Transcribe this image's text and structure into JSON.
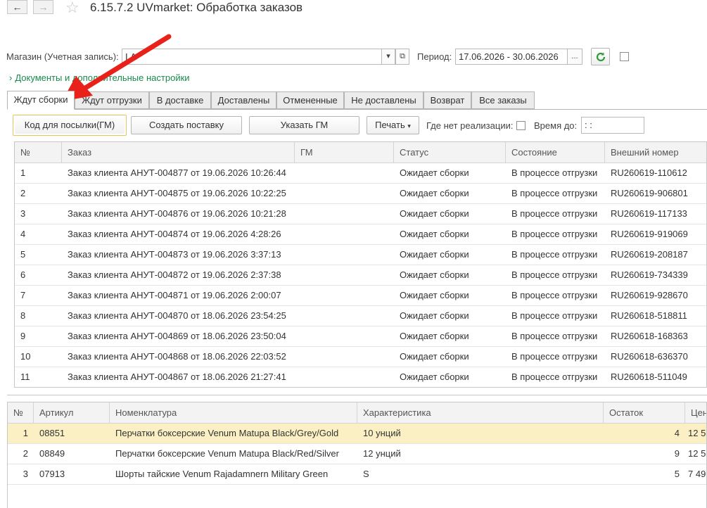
{
  "window": {
    "title": "6.15.7.2 UVmarket: Обработка заказов",
    "back": "←",
    "forward": "→",
    "star": "☆"
  },
  "form": {
    "shop_label": "Магазин (Учетная запись):",
    "shop_value": "I.A",
    "period_label": "Период:",
    "period_value": "17.06.2026 - 30.06.2026",
    "period_btn": "...",
    "docs_link": "Документы и дополнительные настройки"
  },
  "tabs": [
    "Ждут сборки",
    "Ждут отгрузки",
    "В доставке",
    "Доставлены",
    "Отмененные",
    "Не доставлены",
    "Возврат",
    "Все заказы"
  ],
  "toolbar": {
    "code_btn": "Код для посылки(ГМ)",
    "create_btn": "Создать поставку",
    "gm_btn": "Указать ГМ",
    "print_btn": "Печать",
    "no_real_label": "Где нет реализации:",
    "time_label": "Время до:",
    "time_value": " :  : "
  },
  "orders": {
    "columns": [
      "№",
      "Заказ",
      "ГМ",
      "Статус",
      "Состояние",
      "Внешний номер"
    ],
    "rows": [
      [
        "1",
        "Заказ клиента АНУТ-004877 от 19.06.2026 10:26:44",
        "",
        "Ожидает сборки",
        "В процессе отгрузки",
        "RU260619-110612"
      ],
      [
        "2",
        "Заказ клиента АНУТ-004875 от 19.06.2026 10:22:25",
        "",
        "Ожидает сборки",
        "В процессе отгрузки",
        "RU260619-906801"
      ],
      [
        "3",
        "Заказ клиента АНУТ-004876 от 19.06.2026 10:21:28",
        "",
        "Ожидает сборки",
        "В процессе отгрузки",
        "RU260619-117133"
      ],
      [
        "4",
        "Заказ клиента АНУТ-004874 от 19.06.2026 4:28:26",
        "",
        "Ожидает сборки",
        "В процессе отгрузки",
        "RU260619-919069"
      ],
      [
        "5",
        "Заказ клиента АНУТ-004873 от 19.06.2026 3:37:13",
        "",
        "Ожидает сборки",
        "В процессе отгрузки",
        "RU260619-208187"
      ],
      [
        "6",
        "Заказ клиента АНУТ-004872 от 19.06.2026 2:37:38",
        "",
        "Ожидает сборки",
        "В процессе отгрузки",
        "RU260619-734339"
      ],
      [
        "7",
        "Заказ клиента АНУТ-004871 от 19.06.2026 2:00:07",
        "",
        "Ожидает сборки",
        "В процессе отгрузки",
        "RU260619-928670"
      ],
      [
        "8",
        "Заказ клиента АНУТ-004870 от 18.06.2026 23:54:25",
        "",
        "Ожидает сборки",
        "В процессе отгрузки",
        "RU260618-518811"
      ],
      [
        "9",
        "Заказ клиента АНУТ-004869 от 18.06.2026 23:50:04",
        "",
        "Ожидает сборки",
        "В процессе отгрузки",
        "RU260618-168363"
      ],
      [
        "10",
        "Заказ клиента АНУТ-004868 от 18.06.2026 22:03:52",
        "",
        "Ожидает сборки",
        "В процессе отгрузки",
        "RU260618-636370"
      ],
      [
        "11",
        "Заказ клиента АНУТ-004867 от 18.06.2026 21:27:41",
        "",
        "Ожидает сборки",
        "В процессе отгрузки",
        "RU260618-511049"
      ]
    ]
  },
  "items": {
    "columns": [
      "№",
      "Артикул",
      "Номенклатура",
      "Характеристика",
      "Остаток",
      "Цен"
    ],
    "rows": [
      [
        "1",
        "08851",
        "Перчатки боксерские Venum Matupa Black/Grey/Gold",
        "10 унций",
        "4",
        "12 5"
      ],
      [
        "2",
        "08849",
        "Перчатки боксерские Venum Matupa Black/Red/Silver",
        "12 унций",
        "9",
        "12 5"
      ],
      [
        "3",
        "07913",
        "Шорты тайские Venum Rajadamnern Military Green",
        "S",
        "5",
        "7 49"
      ]
    ]
  },
  "colors": {
    "accent_green": "#1a8a4c",
    "selection": "#fbf0c4",
    "annotation_arrow": "#e8221b"
  }
}
